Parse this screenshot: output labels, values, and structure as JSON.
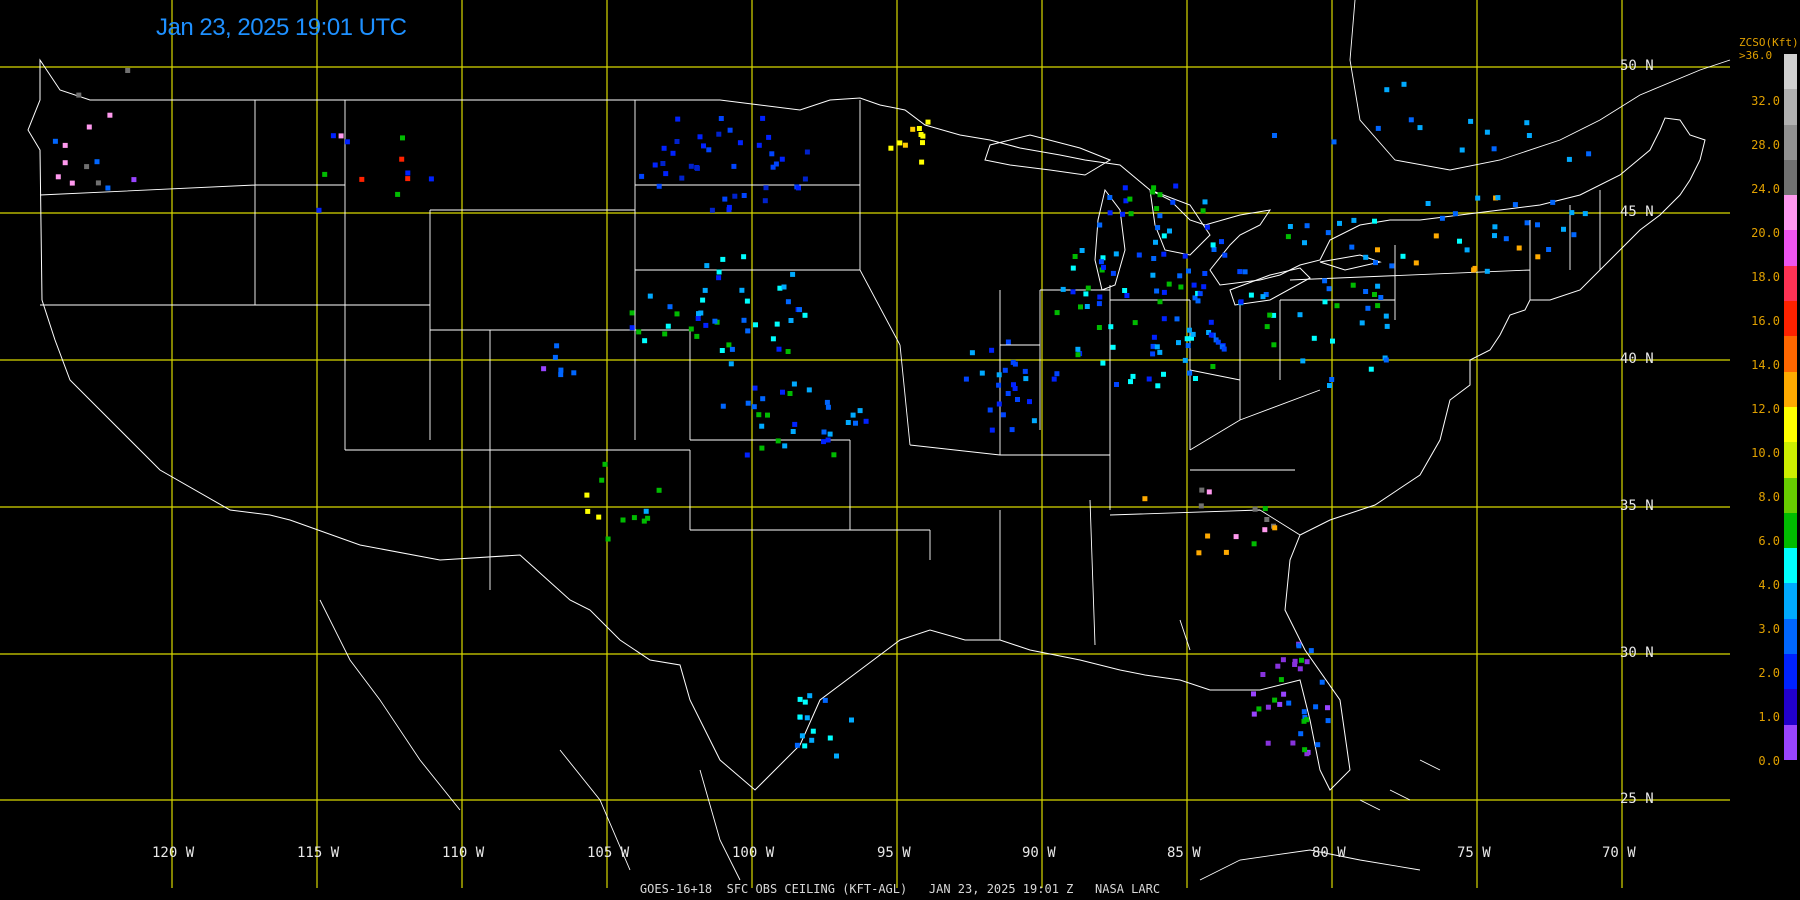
{
  "title": "Jan 23, 2025 19:01 UTC",
  "footer": "GOES-16+18  SFC OBS CEILING (KFT-AGL)   JAN 23, 2025 19:01 Z   NASA LARC",
  "lat_labels": [
    "50 N",
    "45 N",
    "40 N",
    "35 N",
    "30 N",
    "25 N"
  ],
  "lon_labels": [
    "120 W",
    "115 W",
    "110 W",
    "105 W",
    "100 W",
    "95 W",
    "90 W",
    "85 W",
    "80 W",
    "75 W",
    "70 W"
  ],
  "legend": {
    "title_line1": "ZCSO(Kft)",
    "title_line2": ">36.0",
    "values": [
      "32.0",
      "28.0",
      "24.0",
      "20.0",
      "18.0",
      "16.0",
      "14.0",
      "12.0",
      "10.0",
      "8.0",
      "6.0",
      "4.0",
      "3.0",
      "2.0",
      "1.0",
      "0.0"
    ],
    "colors": [
      "#d0d0d0",
      "#b0b0b0",
      "#909090",
      "#707070",
      "#ff99ee",
      "#ee55ee",
      "#ff3355",
      "#ff2200",
      "#ff6600",
      "#ffaa00",
      "#ffff00",
      "#ccee00",
      "#66cc00",
      "#00bb00",
      "#00ffff",
      "#00aaff",
      "#0066ff",
      "#0022ff",
      "#2200cc",
      "#9944ff"
    ]
  },
  "colors": {
    "grid": "#d8d800",
    "borders": "#ffffff",
    "title": "#1e90ff",
    "legend_text": "#e0a000"
  }
}
